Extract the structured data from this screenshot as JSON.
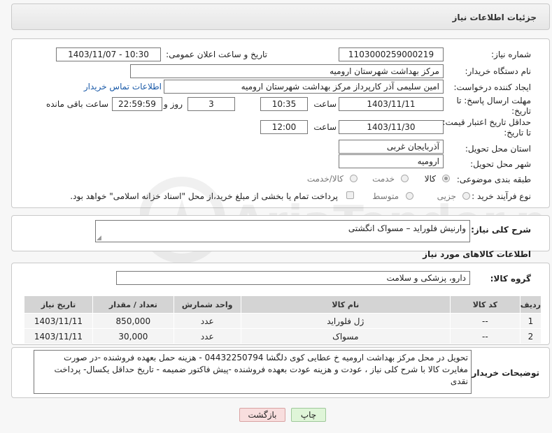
{
  "header": {
    "title": "جزئیات اطلاعات نیاز"
  },
  "form": {
    "need_number": {
      "label": "شماره نیاز:",
      "value": "1103000259000219"
    },
    "announce_datetime": {
      "label": "تاریخ و ساعت اعلان عمومی:",
      "value": "1403/11/07 - 10:30"
    },
    "buyer_org": {
      "label": "نام دستگاه خریدار:",
      "value": "مرکز بهداشت شهرستان ارومیه"
    },
    "requester": {
      "label": "ایجاد کننده درخواست:",
      "value": "امین سلیمی آذر کارپرداز مرکز بهداشت شهرستان ارومیه",
      "contact_link": "اطلاعات تماس خریدار"
    },
    "deadline": {
      "label": "مهلت ارسال پاسخ: تا تاریخ:",
      "date": "1403/11/11",
      "time_label": "ساعت",
      "time": "10:35",
      "days": "3",
      "days_label": "روز و",
      "remaining": "22:59:59",
      "remaining_label": "ساعت باقی مانده"
    },
    "validity": {
      "label": "حداقل تاریخ اعتبار قیمت: تا تاریخ:",
      "date": "1403/11/30",
      "time_label": "ساعت",
      "time": "12:00"
    },
    "province": {
      "label": "استان محل تحویل:",
      "value": "آذربایجان غربی"
    },
    "city": {
      "label": "شهر محل تحویل:",
      "value": "ارومیه"
    },
    "category": {
      "label": "طبقه بندی موضوعی:",
      "options": [
        "کالا",
        "خدمت",
        "کالا/خدمت"
      ],
      "selected": "کالا"
    },
    "purchase_type": {
      "label": "نوع فرآیند خرید :",
      "options": [
        "جزیی",
        "متوسط"
      ],
      "note": "پرداخت تمام یا بخشی از مبلغ خرید،از محل \"اسناد خزانه اسلامی\" خواهد بود."
    }
  },
  "summary": {
    "label": "شرح کلی نیاز:",
    "value": "وارنیش فلوراید – مسواک انگشتی"
  },
  "goods_section": {
    "title": "اطلاعات کالاهای مورد نیاز",
    "group_label": "گروه کالا:",
    "group_value": "دارو، پزشکی و سلامت",
    "columns": [
      "ردیف",
      "کد کالا",
      "نام کالا",
      "واحد شمارش",
      "تعداد / مقدار",
      "تاریخ نیاز"
    ],
    "rows": [
      {
        "row": "1",
        "code": "--",
        "name": "ژل فلوراید",
        "unit": "عدد",
        "qty": "850,000",
        "date": "1403/11/11"
      },
      {
        "row": "2",
        "code": "--",
        "name": "مسواک",
        "unit": "عدد",
        "qty": "30,000",
        "date": "1403/11/11"
      }
    ]
  },
  "notes": {
    "label": "توضیحات خریدار:",
    "value": "تحویل در محل مرکز بهداشت ارومیه خ عطایی کوی دلگشا 04432250794 - هزینه حمل بعهده فروشنده -در صورت مغایرت کالا با شرح کلی نیاز ، عودت و هزینه عودت بعهده فروشنده -پیش فاکتور  ضمیمه - تاریخ حداقل یکسال- پرداخت نقدی"
  },
  "buttons": {
    "print": "چاپ",
    "back": "بازگشت"
  },
  "watermark": "AriaTender.net",
  "colors": {
    "link": "#1a5aa8",
    "print_bg": "#dff5d8",
    "back_bg": "#f8dede"
  }
}
